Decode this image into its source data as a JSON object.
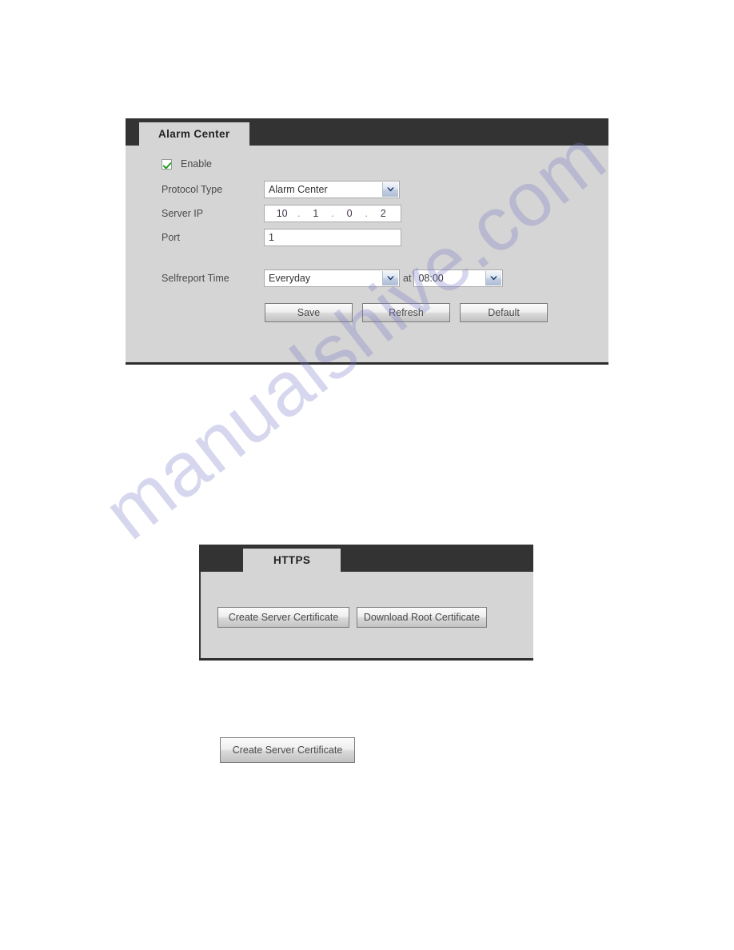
{
  "watermark": {
    "text": "manualshive.com",
    "color": "#7876c8"
  },
  "alarm_center_panel": {
    "tab_label": "Alarm Center",
    "enable": {
      "label": "Enable",
      "checked": true
    },
    "protocol_type": {
      "label": "Protocol Type",
      "value": "Alarm Center"
    },
    "server_ip": {
      "label": "Server IP",
      "octets": [
        "10",
        "1",
        "0",
        "2"
      ],
      "separator": "."
    },
    "port": {
      "label": "Port",
      "value": "1"
    },
    "selfreport_time": {
      "label": "Selfreport Time",
      "day_value": "Everyday",
      "at_text": "at",
      "time_value": "08:00"
    },
    "buttons": {
      "save": "Save",
      "refresh": "Refresh",
      "default": "Default"
    }
  },
  "https_panel": {
    "tab_label": "HTTPS",
    "buttons": {
      "create_server_certificate": "Create Server Certificate",
      "download_root_certificate": "Download Root Certificate"
    }
  },
  "standalone_button": {
    "label": "Create Server Certificate"
  }
}
